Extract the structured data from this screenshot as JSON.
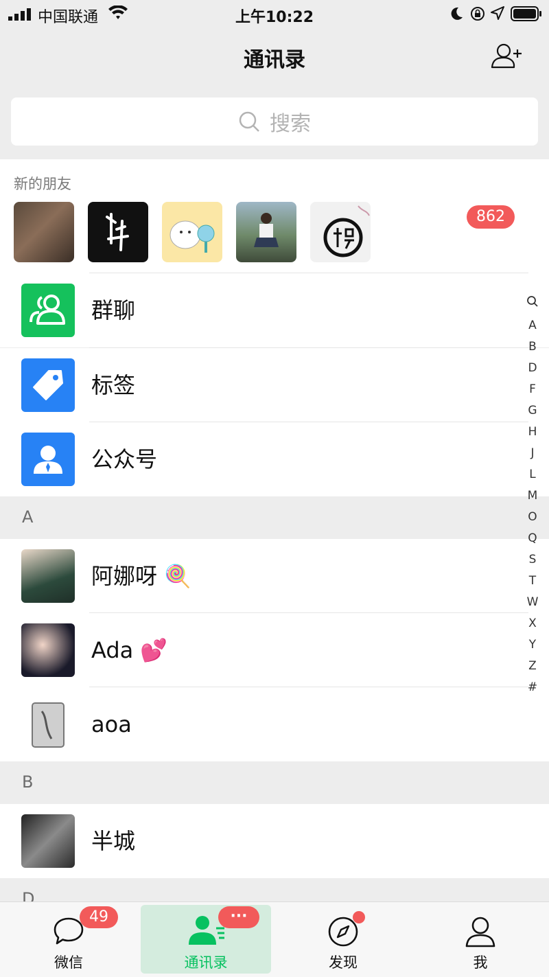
{
  "status": {
    "carrier": "中国联通",
    "time": "上午10:22"
  },
  "nav": {
    "title": "通讯录"
  },
  "search": {
    "placeholder": "搜索"
  },
  "new_friends": {
    "label": "新的朋友",
    "badge": "862"
  },
  "menu": [
    {
      "label": "群聊",
      "icon": "group-icon",
      "color": "#15c15c"
    },
    {
      "label": "标签",
      "icon": "tag-icon",
      "color": "#2782f5"
    },
    {
      "label": "公众号",
      "icon": "official-account-icon",
      "color": "#2782f5"
    }
  ],
  "sections": [
    {
      "letter": "A",
      "contacts": [
        "阿娜呀 🍭",
        "Ada 💕",
        "aoa"
      ]
    },
    {
      "letter": "B",
      "contacts": [
        "半城"
      ]
    },
    {
      "letter": "D",
      "contacts": []
    }
  ],
  "index": [
    "Q",
    "A",
    "B",
    "D",
    "F",
    "G",
    "H",
    "J",
    "L",
    "M",
    "O",
    "Q",
    "S",
    "T",
    "W",
    "X",
    "Y",
    "Z",
    "#"
  ],
  "tabs": [
    {
      "label": "微信",
      "badge": "49"
    },
    {
      "label": "通讯录",
      "badge": "···",
      "active": true
    },
    {
      "label": "发现"
    },
    {
      "label": "我"
    }
  ],
  "colors": {
    "accent": "#07c160",
    "badge": "#f25a5a"
  }
}
